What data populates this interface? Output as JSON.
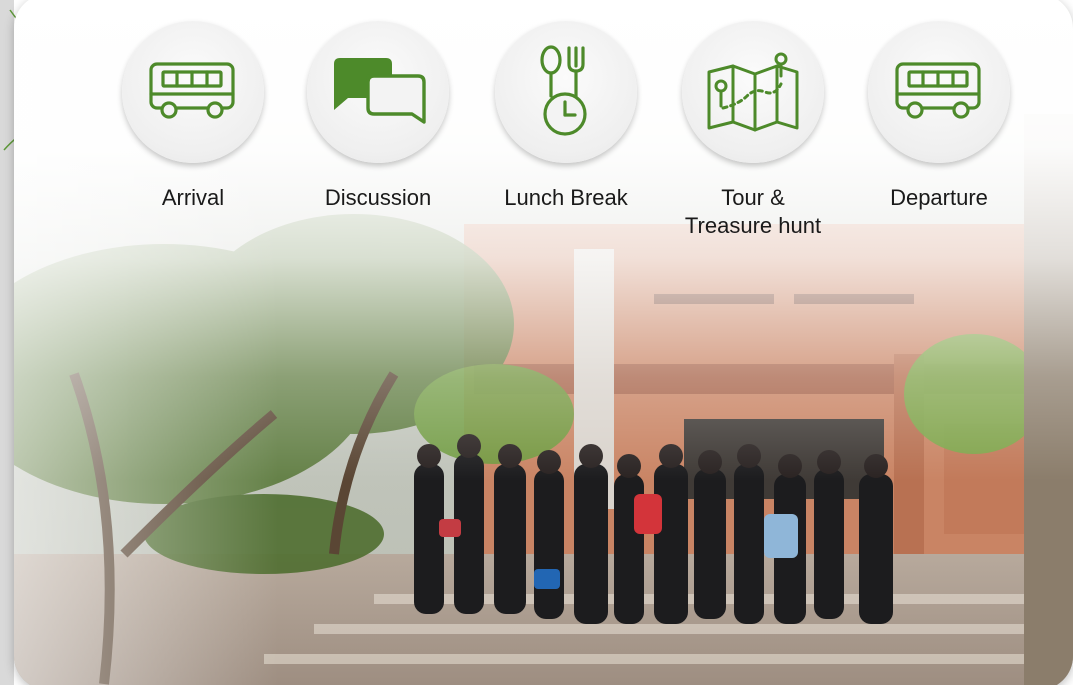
{
  "colors": {
    "accent": "#4d8a2a",
    "text": "#1a1a1a"
  },
  "steps": [
    {
      "label": "Arrival",
      "icon": "bus-icon"
    },
    {
      "label": "Discussion",
      "icon": "chat-bubbles-icon"
    },
    {
      "label": "Lunch Break",
      "icon": "fork-spoon-clock-icon"
    },
    {
      "label": "Tour &\nTreasure hunt",
      "icon": "treasure-map-icon"
    },
    {
      "label": "Departure",
      "icon": "bus-icon"
    }
  ],
  "photo": {
    "subject": "students-courtyard-photo"
  }
}
